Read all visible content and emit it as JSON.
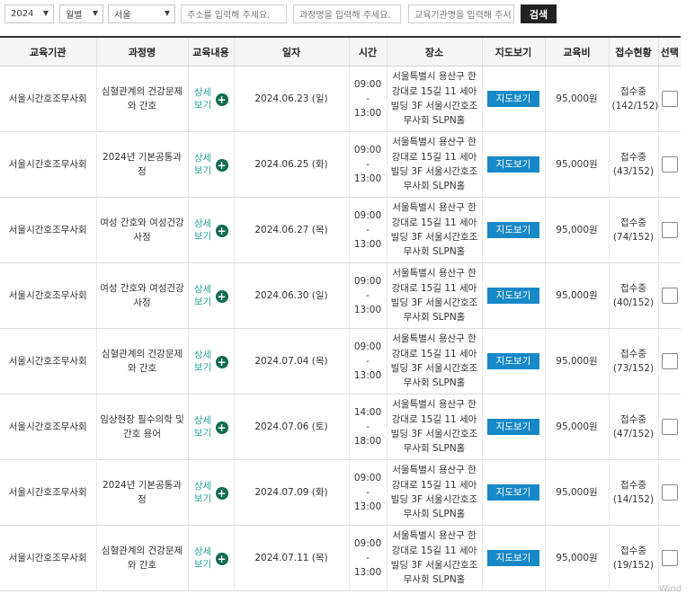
{
  "filters": {
    "year": "2024",
    "month": "월별",
    "region": "서울",
    "address_placeholder": "주소를 입력해 주세요.",
    "course_placeholder": "과정명을 입력해 주세요.",
    "org_placeholder": "교육기관명을 입력해 주서",
    "search_label": "검색"
  },
  "table": {
    "headers": [
      "교육기관",
      "과정명",
      "교육내용",
      "일자",
      "시간",
      "장소",
      "지도보기",
      "교육비",
      "접수현황",
      "선택"
    ],
    "rows": [
      {
        "org": "서울시간호조무사회",
        "course": "심혈관계의 건강문제와 간호",
        "detail": "상세보기",
        "date": "2024.06.23 (일)",
        "time": "09:00 - 13:00",
        "place": "서울특별시 용산구 한강대로 15길 11 세아빌딩 3F 서울시간호조무사회 SLPN홀",
        "map": "지도보기",
        "fee": "95,000원",
        "status": "접수중",
        "count": "(142/152)"
      },
      {
        "org": "서울시간호조무사회",
        "course": "2024년 기본공통과정",
        "detail": "상세보기",
        "date": "2024.06.25 (화)",
        "time": "09:00 - 13:00",
        "place": "서울특별시 용산구 한강대로 15길 11 세아빌딩 3F 서울시간호조무사회 SLPN홀",
        "map": "지도보기",
        "fee": "95,000원",
        "status": "접수중",
        "count": "(43/152)"
      },
      {
        "org": "서울시간호조무사회",
        "course": "여성 간호와 여성건강사정",
        "detail": "상세보기",
        "date": "2024.06.27 (목)",
        "time": "09:00 - 13:00",
        "place": "서울특별시 용산구 한강대로 15길 11 세아빌딩 3F 서울시간호조무사회 SLPN홀",
        "map": "지도보기",
        "fee": "95,000원",
        "status": "접수중",
        "count": "(74/152)"
      },
      {
        "org": "서울시간호조무사회",
        "course": "여성 간호와 여성건강사정",
        "detail": "상세보기",
        "date": "2024.06.30 (일)",
        "time": "09:00 - 13:00",
        "place": "서울특별시 용산구 한강대로 15길 11 세아빌딩 3F 서울시간호조무사회 SLPN홀",
        "map": "지도보기",
        "fee": "95,000원",
        "status": "접수중",
        "count": "(40/152)"
      },
      {
        "org": "서울시간호조무사회",
        "course": "심혈관계의 건강문제와 간호",
        "detail": "상세보기",
        "date": "2024.07.04 (목)",
        "time": "09:00 - 13:00",
        "place": "서울특별시 용산구 한강대로 15길 11 세아빌딩 3F 서울시간호조무사회 SLPN홀",
        "map": "지도보기",
        "fee": "95,000원",
        "status": "접수중",
        "count": "(73/152)"
      },
      {
        "org": "서울시간호조무사회",
        "course": "임상현장 필수의학 및 간호 용어",
        "detail": "상세보기",
        "date": "2024.07.06 (토)",
        "time": "14:00 - 18:00",
        "place": "서울특별시 용산구 한강대로 15길 11 세아빌딩 3F 서울시간호조무사회 SLPN홀",
        "map": "지도보기",
        "fee": "95,000원",
        "status": "접수중",
        "count": "(47/152)"
      },
      {
        "org": "서울시간호조무사회",
        "course": "2024년 기본공통과정",
        "detail": "상세보기",
        "date": "2024.07.09 (화)",
        "time": "09:00 - 13:00",
        "place": "서울특별시 용산구 한강대로 15길 11 세아빌딩 3F 서울시간호조무사회 SLPN홀",
        "map": "지도보기",
        "fee": "95,000원",
        "status": "접수중",
        "count": "(14/152)"
      },
      {
        "org": "서울시간호조무사회",
        "course": "심혈관계의 건강문제와 간호",
        "detail": "상세보기",
        "date": "2024.07.11 (목)",
        "time": "09:00 - 13:00",
        "place": "서울특별시 용산구 한강대로 15길 11 세아빌딩 3F 서울시간호조무사회 SLPN홀",
        "map": "지도보기",
        "fee": "95,000원",
        "status": "접수중",
        "count": "(19/152)"
      }
    ]
  },
  "colors": {
    "map_button": "#1788c8",
    "detail_text": "#2aa39a",
    "plus_icon": "#0f6b4f",
    "search_button": "#222222"
  },
  "icons": {
    "detail": "plus-circle-icon",
    "dropdown": "chevron-down-icon"
  }
}
